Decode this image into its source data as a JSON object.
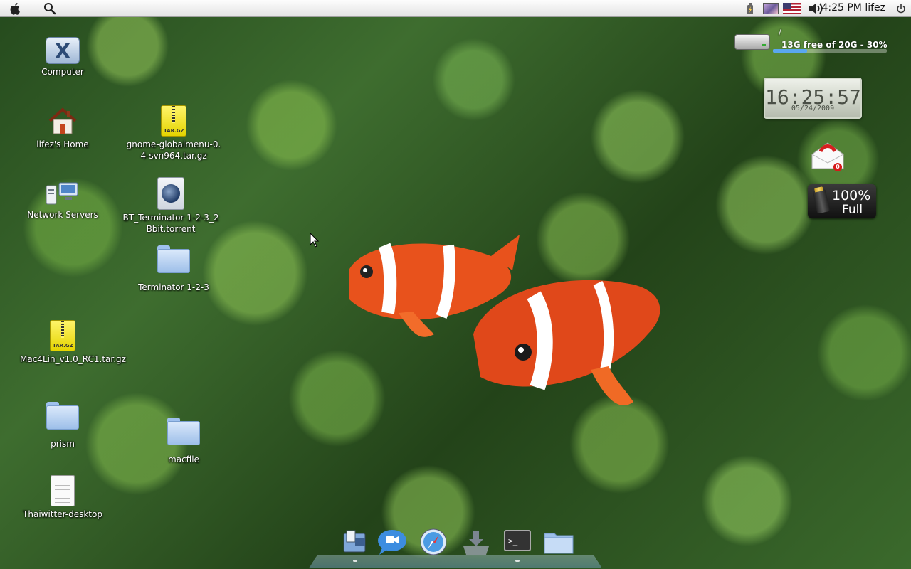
{
  "menubar": {
    "clock": "4:25 PM",
    "user": "lifez",
    "icons": [
      "apple-icon",
      "search-icon",
      "battery-tray-icon",
      "image-tray-icon",
      "us-flag-icon",
      "volume-icon",
      "power-icon"
    ]
  },
  "desktop": {
    "icons": [
      {
        "label": "Computer",
        "icon": "computer-icon"
      },
      {
        "label": "lifez's Home",
        "icon": "home-icon"
      },
      {
        "label": "Network Servers",
        "icon": "network-icon"
      },
      {
        "label": "Mac4Lin_v1.0_RC1.tar.gz",
        "icon": "archive-icon"
      },
      {
        "label": "prism",
        "icon": "folder-icon"
      },
      {
        "label": "Thaiwitter-desktop",
        "icon": "document-icon"
      },
      {
        "label": "gnome-globalmenu-0.4-svn964.tar.gz",
        "icon": "archive-icon"
      },
      {
        "label": "BT_Terminator 1-2-3_2Bbit.torrent",
        "icon": "torrent-icon"
      },
      {
        "label": "Terminator 1-2-3",
        "icon": "folder-icon"
      },
      {
        "label": "macfile",
        "icon": "folder-icon"
      }
    ]
  },
  "widgets": {
    "disk": {
      "mount": "/",
      "text": "13G free of 20G - 30%",
      "used_fraction": 0.3
    },
    "clock": {
      "time": "16:25:57",
      "date": "05/24/2009"
    },
    "mail": {
      "count": "0"
    },
    "battery": {
      "percent": "100%",
      "status": "Full"
    }
  },
  "dock": {
    "items": [
      "finder-icon",
      "chat-icon",
      "safari-icon",
      "downloads-icon",
      "terminal-icon",
      "folder-icon"
    ]
  },
  "colors": {
    "menubar_bg": "#e8e8e8",
    "fish_orange": "#e8521c",
    "folder_blue": "#9dbfe9",
    "accent_blue": "#5aa7f0"
  }
}
